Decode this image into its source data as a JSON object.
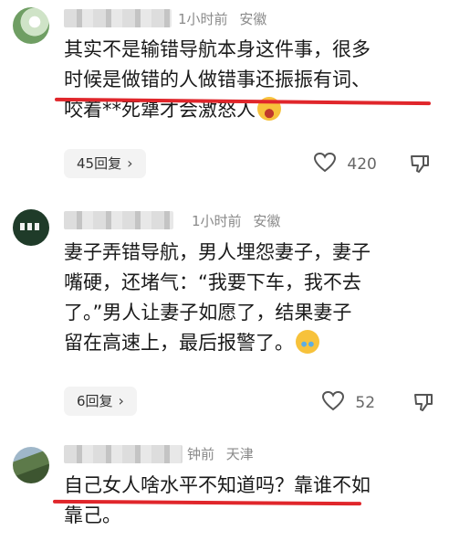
{
  "comments": [
    {
      "time": "1小时前",
      "location": "安徽",
      "lines": [
        {
          "pre": "其实不是输错导航本身这件事，很多",
          "u": ""
        },
        {
          "pre": "时候",
          "u": "是做错的人做错事还振振有词、"
        },
        {
          "pre": "咬着**死犟才会激怒人",
          "u": ""
        }
      ],
      "reply_label": "45回复",
      "likes": "420"
    },
    {
      "time": "1小时前",
      "location": "安徽",
      "lines": [
        {
          "pre": "妻子弄错导航，男人埋怨妻子，妻子"
        },
        {
          "pre": "嘴硬，还堵气：“我要下车，我不去"
        },
        {
          "pre": "了。”男人让妻子如愿了，结果妻子"
        },
        {
          "pre": "留在高速上，最后报警了。"
        }
      ],
      "reply_label": "6回复",
      "likes": "52"
    },
    {
      "time": "钟前",
      "location": "天津",
      "lines": [
        {
          "pre": "",
          "u": "自己女人啥水平不知道吗？",
          "post": "靠谁不如"
        },
        {
          "pre": "靠己。"
        }
      ]
    }
  ],
  "colors": {
    "underline": "#e0262b",
    "meta": "#8a8a8a"
  }
}
